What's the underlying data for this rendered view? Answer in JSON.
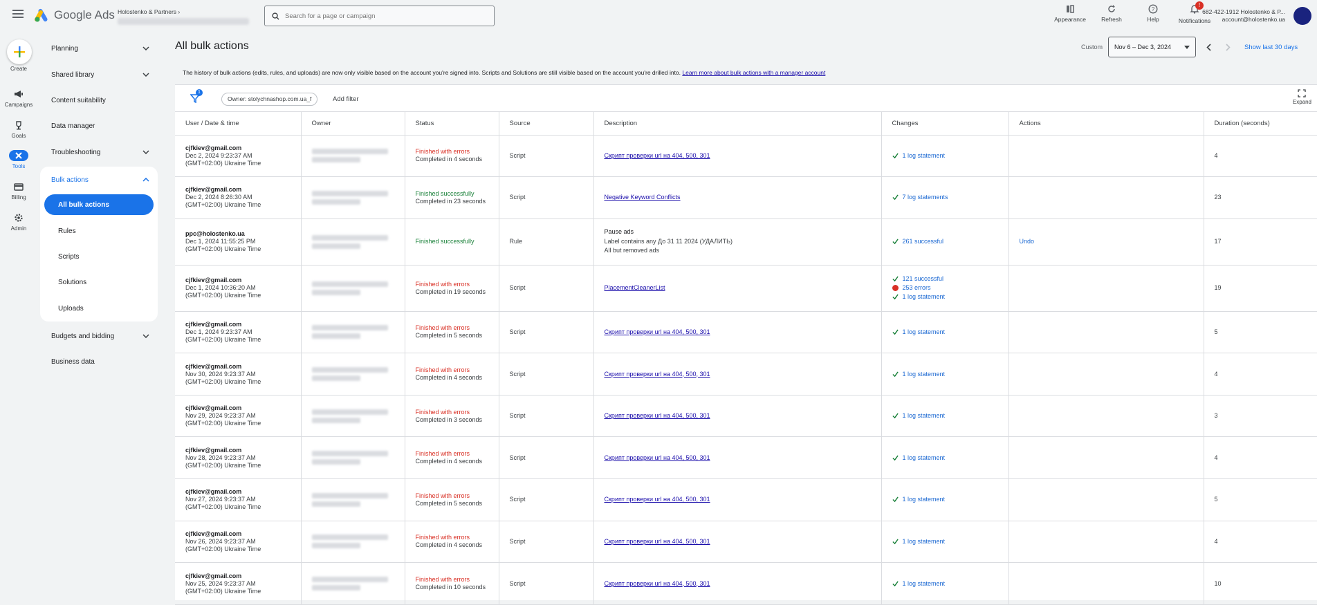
{
  "header": {
    "app_name": "Google Ads",
    "account_name": "Holostenko & Partners",
    "search_placeholder": "Search for a page or campaign",
    "actions": [
      {
        "label": "Appearance",
        "icon": "appearance-icon"
      },
      {
        "label": "Refresh",
        "icon": "refresh-icon"
      },
      {
        "label": "Help",
        "icon": "help-icon"
      },
      {
        "label": "Notifications",
        "icon": "notifications-icon",
        "badge": "!"
      }
    ],
    "account_line1": "682-422-1912 Holostenko & P...",
    "account_line2": "account@holostenko.ua"
  },
  "rail": {
    "create": "Create",
    "campaigns": "Campaigns",
    "goals": "Goals",
    "tools": "Tools",
    "billing": "Billing",
    "admin": "Admin"
  },
  "sidenav": {
    "planning": "Planning",
    "shared_library": "Shared library",
    "content_suitability": "Content suitability",
    "data_manager": "Data manager",
    "troubleshooting": "Troubleshooting",
    "bulk_actions": "Bulk actions",
    "sub": [
      "All bulk actions",
      "Rules",
      "Scripts",
      "Solutions",
      "Uploads"
    ],
    "budgets": "Budgets and bidding",
    "business_data": "Business data"
  },
  "page": {
    "title": "All bulk actions",
    "date_label": "Custom",
    "date_range": "Nov 6 – Dec 3, 2024",
    "show_last": "Show last 30 days",
    "notice": "The history of bulk actions (edits, rules, and uploads) are now only visible based on the account you're signed into. Scripts and Solutions are still visible based on the account you're drilled into.",
    "notice_link": "Learn more about bulk actions with a manager account"
  },
  "toolbar": {
    "filter_count": "1",
    "chip": "Owner: stolychnashop.com.ua_f",
    "add_filter": "Add filter",
    "expand": "Expand"
  },
  "table": {
    "columns": [
      "User / Date & time",
      "Owner",
      "Status",
      "Source",
      "Description",
      "Changes",
      "Actions",
      "Duration (seconds)"
    ],
    "rows": [
      {
        "user": "cjfkiev@gmail.com",
        "date": "Dec 2, 2024 9:23:37 AM",
        "tz": "(GMT+02:00) Ukraine Time",
        "status": "Finished with errors",
        "status_type": "err",
        "completed": "Completed in 4 seconds",
        "source": "Script",
        "desc": "Скрипт проверки url на 404, 500, 301",
        "changes": [
          {
            "type": "ok",
            "text": "1 log statement"
          }
        ],
        "action": "",
        "duration": "4"
      },
      {
        "user": "cjfkiev@gmail.com",
        "date": "Dec 2, 2024 8:26:30 AM",
        "tz": "(GMT+02:00) Ukraine Time",
        "status": "Finished successfully",
        "status_type": "ok",
        "completed": "Completed in 23 seconds",
        "source": "Script",
        "desc": "Negative Keyword Conflicts",
        "changes": [
          {
            "type": "ok",
            "text": "7 log statements"
          }
        ],
        "action": "",
        "duration": "23"
      },
      {
        "user": "ppc@holostenko.ua",
        "date": "Dec 1, 2024 11:55:25 PM",
        "tz": "(GMT+02:00) Ukraine Time",
        "status": "Finished successfully",
        "status_type": "ok",
        "completed": "",
        "source": "Rule",
        "desc_plain": [
          "Pause ads",
          "Label contains any До 31 11 2024 (УДАЛИТЬ)",
          "All but removed ads"
        ],
        "changes": [
          {
            "type": "ok",
            "text": "261 successful"
          }
        ],
        "action": "Undo",
        "duration": "17"
      },
      {
        "user": "cjfkiev@gmail.com",
        "date": "Dec 1, 2024 10:36:20 AM",
        "tz": "(GMT+02:00) Ukraine Time",
        "status": "Finished with errors",
        "status_type": "err",
        "completed": "Completed in 19 seconds",
        "source": "Script",
        "desc": "PlacementCleanerList",
        "changes": [
          {
            "type": "ok",
            "text": "121 successful"
          },
          {
            "type": "err",
            "text": "253 errors"
          },
          {
            "type": "ok",
            "text": "1 log statement"
          }
        ],
        "action": "",
        "duration": "19"
      },
      {
        "user": "cjfkiev@gmail.com",
        "date": "Dec 1, 2024 9:23:37 AM",
        "tz": "(GMT+02:00) Ukraine Time",
        "status": "Finished with errors",
        "status_type": "err",
        "completed": "Completed in 5 seconds",
        "source": "Script",
        "desc": "Скрипт проверки url на 404, 500, 301",
        "changes": [
          {
            "type": "ok",
            "text": "1 log statement"
          }
        ],
        "action": "",
        "duration": "5"
      },
      {
        "user": "cjfkiev@gmail.com",
        "date": "Nov 30, 2024 9:23:37 AM",
        "tz": "(GMT+02:00) Ukraine Time",
        "status": "Finished with errors",
        "status_type": "err",
        "completed": "Completed in 4 seconds",
        "source": "Script",
        "desc": "Скрипт проверки url на 404, 500, 301",
        "changes": [
          {
            "type": "ok",
            "text": "1 log statement"
          }
        ],
        "action": "",
        "duration": "4"
      },
      {
        "user": "cjfkiev@gmail.com",
        "date": "Nov 29, 2024 9:23:37 AM",
        "tz": "(GMT+02:00) Ukraine Time",
        "status": "Finished with errors",
        "status_type": "err",
        "completed": "Completed in 3 seconds",
        "source": "Script",
        "desc": "Скрипт проверки url на 404, 500, 301",
        "changes": [
          {
            "type": "ok",
            "text": "1 log statement"
          }
        ],
        "action": "",
        "duration": "3"
      },
      {
        "user": "cjfkiev@gmail.com",
        "date": "Nov 28, 2024 9:23:37 AM",
        "tz": "(GMT+02:00) Ukraine Time",
        "status": "Finished with errors",
        "status_type": "err",
        "completed": "Completed in 4 seconds",
        "source": "Script",
        "desc": "Скрипт проверки url на 404, 500, 301",
        "changes": [
          {
            "type": "ok",
            "text": "1 log statement"
          }
        ],
        "action": "",
        "duration": "4"
      },
      {
        "user": "cjfkiev@gmail.com",
        "date": "Nov 27, 2024 9:23:37 AM",
        "tz": "(GMT+02:00) Ukraine Time",
        "status": "Finished with errors",
        "status_type": "err",
        "completed": "Completed in 5 seconds",
        "source": "Script",
        "desc": "Скрипт проверки url на 404, 500, 301",
        "changes": [
          {
            "type": "ok",
            "text": "1 log statement"
          }
        ],
        "action": "",
        "duration": "5"
      },
      {
        "user": "cjfkiev@gmail.com",
        "date": "Nov 26, 2024 9:23:37 AM",
        "tz": "(GMT+02:00) Ukraine Time",
        "status": "Finished with errors",
        "status_type": "err",
        "completed": "Completed in 4 seconds",
        "source": "Script",
        "desc": "Скрипт проверки url на 404, 500, 301",
        "changes": [
          {
            "type": "ok",
            "text": "1 log statement"
          }
        ],
        "action": "",
        "duration": "4"
      },
      {
        "user": "cjfkiev@gmail.com",
        "date": "Nov 25, 2024 9:23:37 AM",
        "tz": "(GMT+02:00) Ukraine Time",
        "status": "Finished with errors",
        "status_type": "err",
        "completed": "Completed in 10 seconds",
        "source": "Script",
        "desc": "Скрипт проверки url на 404, 500, 301",
        "changes": [
          {
            "type": "ok",
            "text": "1 log statement"
          }
        ],
        "action": "",
        "duration": "10"
      }
    ]
  },
  "colors": {
    "accent": "#1a73e8",
    "error": "#d93025",
    "success": "#188038"
  }
}
